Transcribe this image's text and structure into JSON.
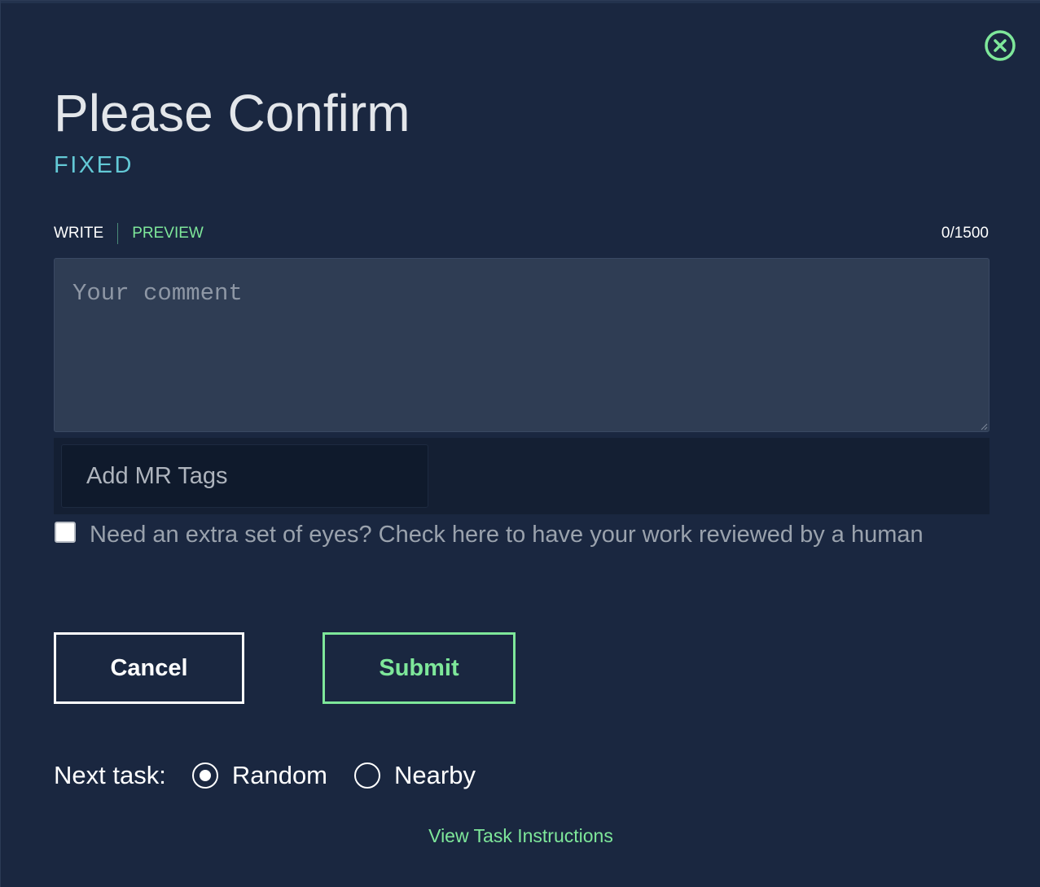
{
  "dialog": {
    "title": "Please Confirm",
    "status": "FIXED"
  },
  "editor": {
    "tab_write": "WRITE",
    "tab_preview": "PREVIEW",
    "char_count": "0/1500",
    "comment_value": "",
    "comment_placeholder": "Your comment"
  },
  "tags": {
    "value": "",
    "placeholder": "Add MR Tags"
  },
  "review": {
    "checked": false,
    "label": "Need an extra set of eyes? Check here to have your work reviewed by a human"
  },
  "actions": {
    "cancel_label": "Cancel",
    "submit_label": "Submit"
  },
  "next_task": {
    "label": "Next task:",
    "options": [
      {
        "label": "Random",
        "selected": true
      },
      {
        "label": "Nearby",
        "selected": false
      }
    ]
  },
  "footer": {
    "instructions_link": "View Task Instructions"
  },
  "colors": {
    "background": "#1a2740",
    "accent_green": "#7ee79a",
    "status_teal": "#63c9d6"
  },
  "icons": {
    "close": "close-circle-icon"
  }
}
